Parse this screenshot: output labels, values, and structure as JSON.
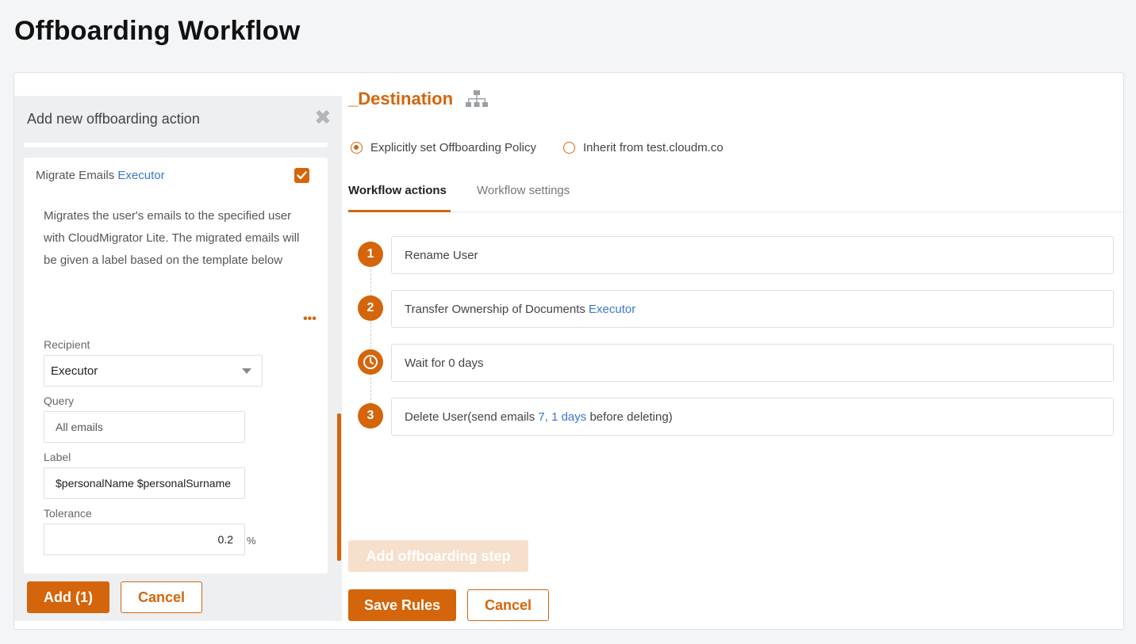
{
  "page": {
    "title": "Offboarding Workflow"
  },
  "left_panel": {
    "header": "Add new offboarding action",
    "close_glyph": "✖",
    "action": {
      "title": "Migrate Emails",
      "title_link": "Executor",
      "checked": true,
      "description": "Migrates the user's emails to the specified user with CloudMigrator Lite. The migrated emails will be given a label based on the template below which can include profile attribute placeholders just like email signatures. The original labels of the migrated emails will be",
      "more_glyph": "•••"
    },
    "fields": {
      "recipient_label": "Recipient",
      "recipient_value": "Executor",
      "query_label": "Query",
      "query_placeholder": "All emails",
      "label_label": "Label",
      "label_value": "$personalName $personalSurname",
      "tolerance_label": "Tolerance",
      "tolerance_value": "0.2",
      "tolerance_unit": "%"
    },
    "buttons": {
      "add": "Add (1)",
      "cancel": "Cancel"
    }
  },
  "right_panel": {
    "destination_title": "_Destination",
    "radio": {
      "explicit": "Explicitly set Offboarding Policy",
      "inherit": "Inherit from test.cloudm.co",
      "selected": "explicit"
    },
    "tabs": [
      {
        "label": "Workflow actions",
        "active": true
      },
      {
        "label": "Workflow settings",
        "active": false
      }
    ],
    "steps": [
      {
        "badge": "1",
        "text": "Rename User",
        "link": "",
        "suffix": ""
      },
      {
        "badge": "2",
        "text": "Transfer Ownership of Documents ",
        "link": "Executor",
        "suffix": ""
      },
      {
        "badge": "clock-icon",
        "text": "Wait for 0 days",
        "link": "",
        "suffix": ""
      },
      {
        "badge": "3",
        "text": "Delete User(send emails ",
        "link": "7, 1 days",
        "suffix": " before deleting)"
      }
    ],
    "buttons": {
      "add_step": "Add offboarding step",
      "save": "Save Rules",
      "cancel": "Cancel"
    }
  },
  "colors": {
    "accent": "#d4650a",
    "link": "#3a79c9",
    "accent_disabled": "#f6dfcb"
  }
}
